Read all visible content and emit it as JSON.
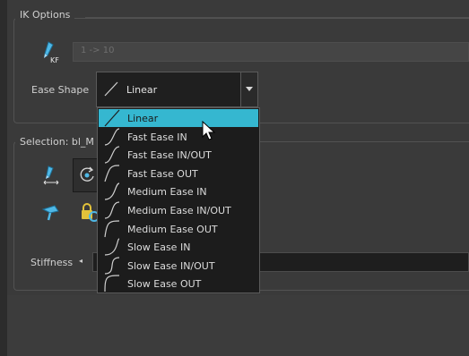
{
  "ik_options": {
    "title": "IK Options",
    "range_text": "1 -> 10",
    "kf_icon": "kf-keyframe-icon",
    "ease_shape_label": "Ease Shape",
    "ease_shape_value": "Linear"
  },
  "selection": {
    "title": "Selection: bl_M",
    "stiffness_label": "Stiffness"
  },
  "ease_menu": {
    "items": [
      {
        "label": "Linear"
      },
      {
        "label": "Fast Ease IN"
      },
      {
        "label": "Fast Ease IN/OUT"
      },
      {
        "label": "Fast Ease OUT"
      },
      {
        "label": "Medium Ease IN"
      },
      {
        "label": "Medium Ease IN/OUT"
      },
      {
        "label": "Medium Ease OUT"
      },
      {
        "label": "Slow Ease IN"
      },
      {
        "label": "Slow Ease IN/OUT"
      },
      {
        "label": "Slow Ease OUT"
      }
    ],
    "selected": "Linear"
  },
  "colors": {
    "highlight": "#35b7d0",
    "icon_blue": "#4fb8e6",
    "lock_yellow": "#e2c23a"
  }
}
